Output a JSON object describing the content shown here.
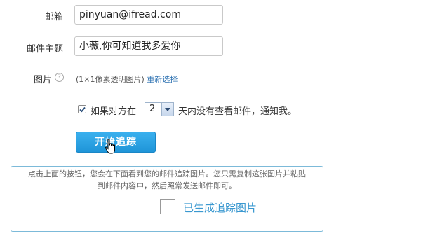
{
  "form": {
    "email": {
      "label": "邮箱",
      "value": "pinyuan@ifread.com"
    },
    "subject": {
      "label": "邮件主题",
      "value": "小薇,你可知道我多爱你"
    },
    "image": {
      "label": "图片",
      "help_icon": "question-icon",
      "note": "(1×1像素透明图片)",
      "reselect_link": "重新选择"
    },
    "notify": {
      "checked": true,
      "prefix": "如果对方在",
      "days_value": "2",
      "suffix": "天内没有查看邮件，通知我。"
    },
    "start_button": {
      "label": "开始追踪",
      "cursor_icon": "hand-pointer-icon"
    }
  },
  "result": {
    "instruction_line1": "点击上面的按钮，您会在下面看到您的邮件追踪图片。您只需复制这张图片并粘贴",
    "instruction_line2": "到邮件内容中，然后照常发送邮件即可。",
    "placeholder_icon": "image-placeholder-icon",
    "status": "已生成追踪图片",
    "accent_color": "#3a98d0",
    "border_color": "#7cbad9"
  }
}
